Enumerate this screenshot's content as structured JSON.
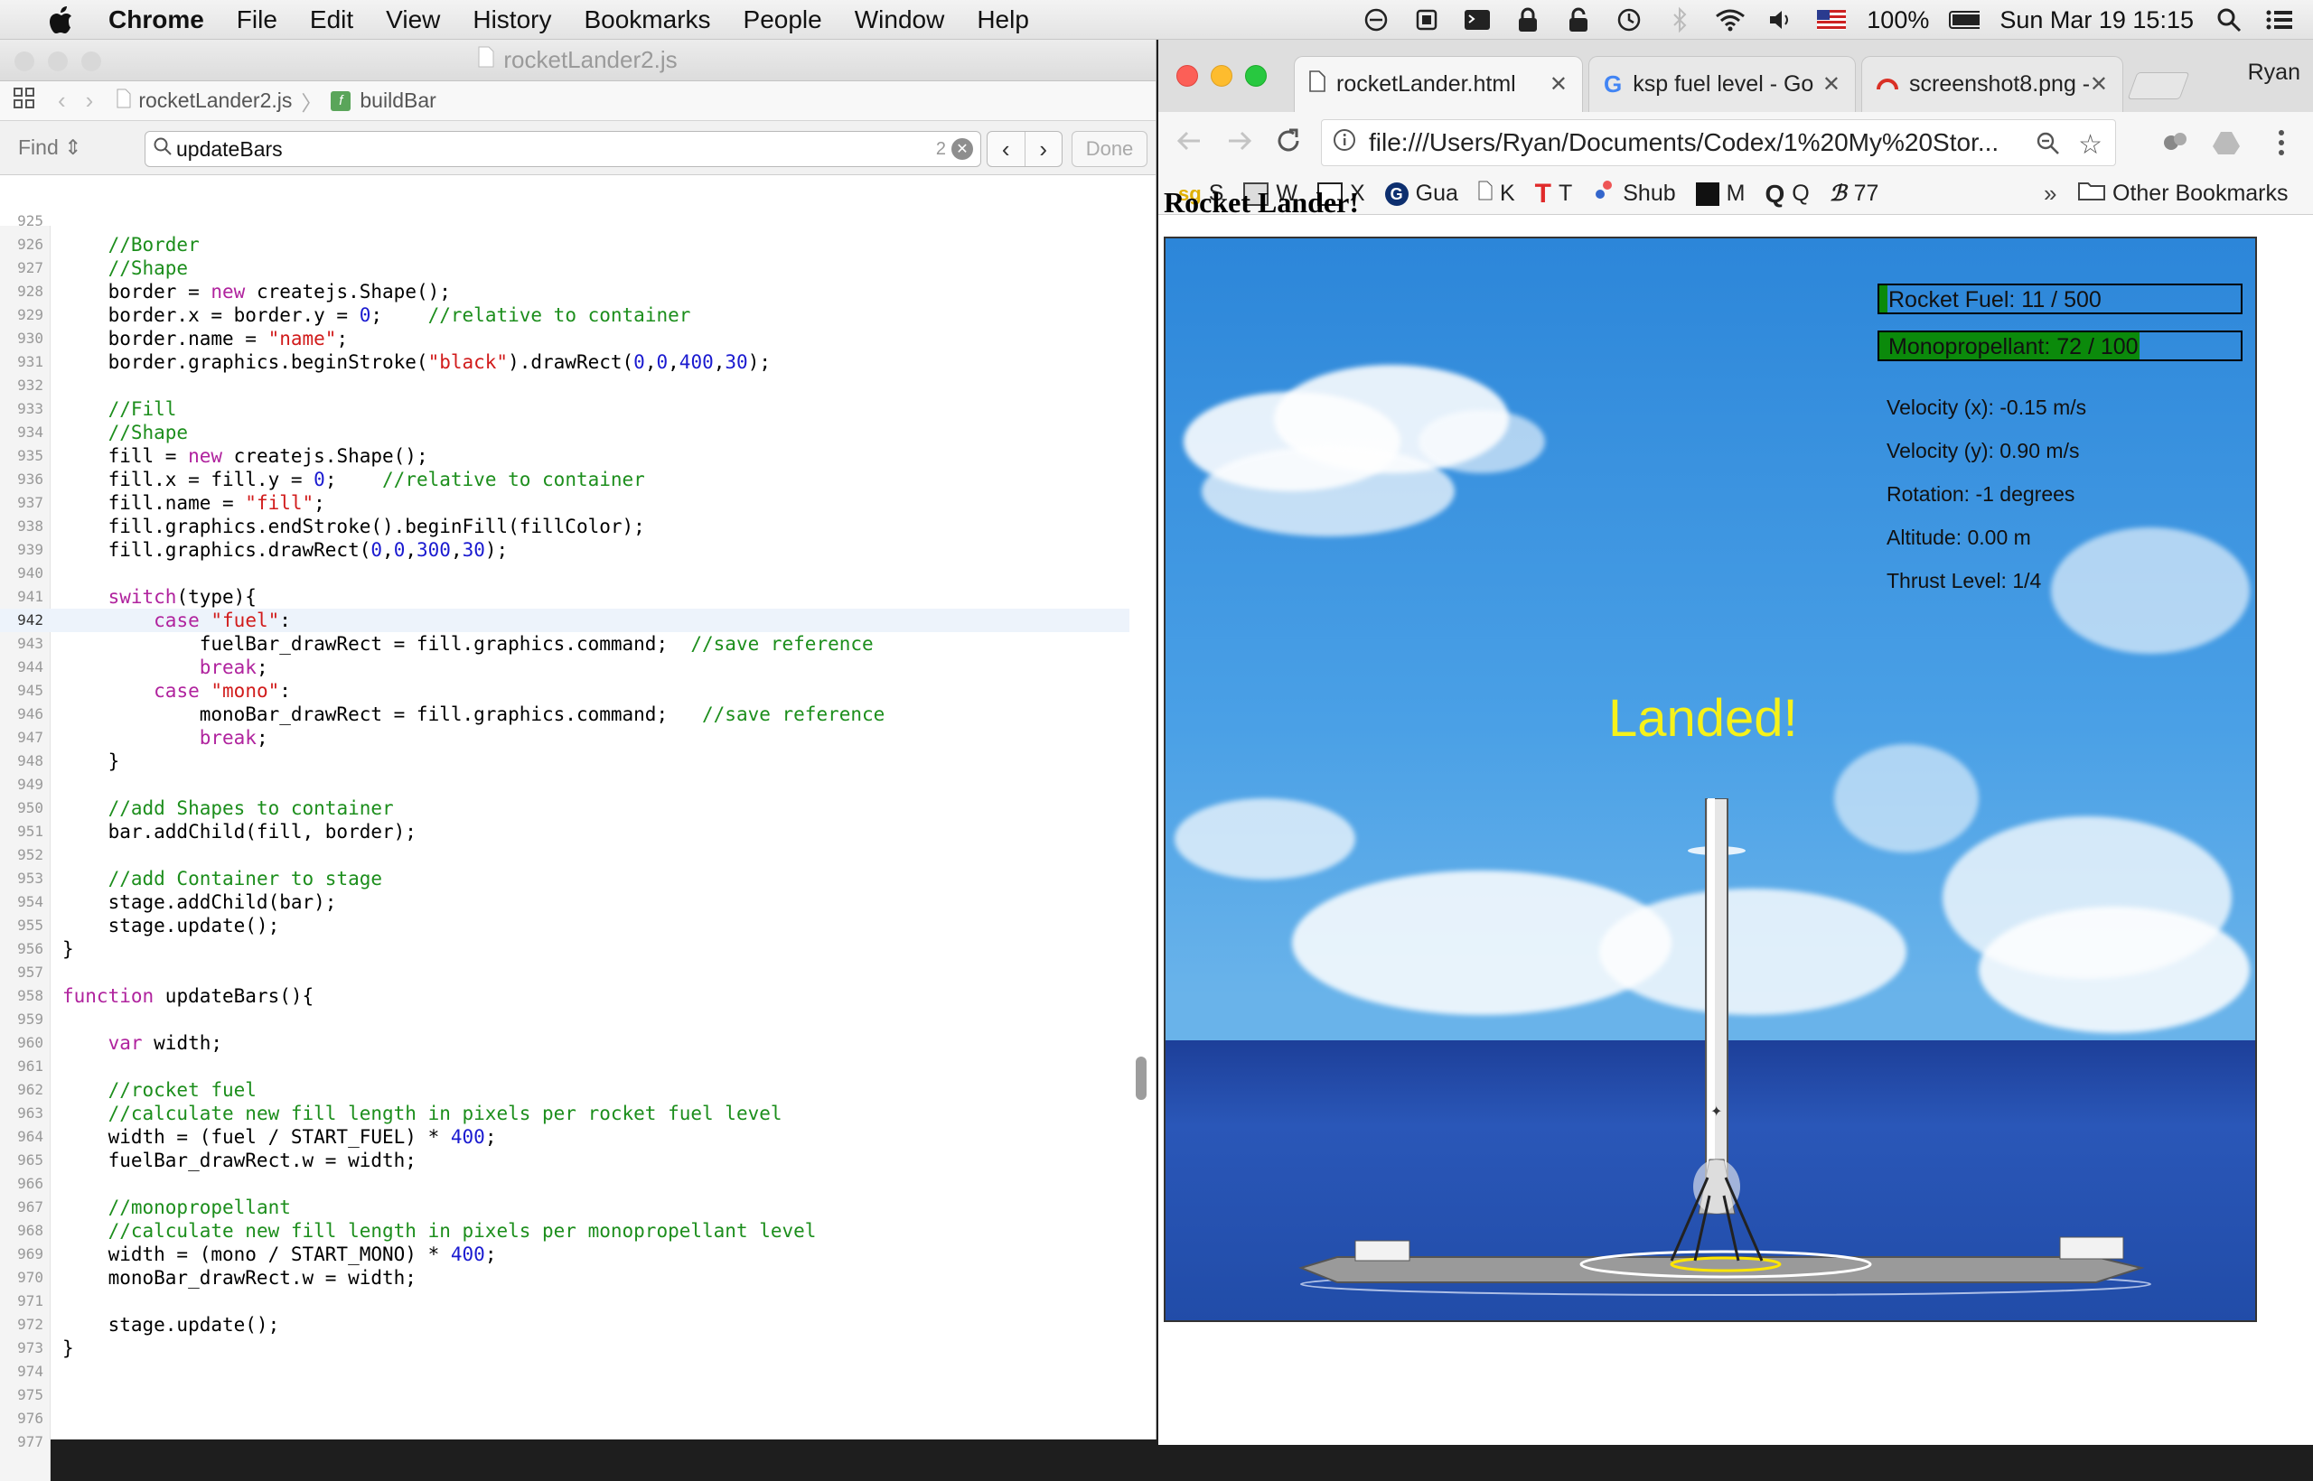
{
  "menubar": {
    "app": "Chrome",
    "items": [
      "File",
      "Edit",
      "View",
      "History",
      "Bookmarks",
      "People",
      "Window",
      "Help"
    ],
    "battery": "100%",
    "datetime": "Sun Mar 19  15:15"
  },
  "editor": {
    "title": "rocketLander2.js",
    "breadcrumb_file": "rocketLander2.js",
    "breadcrumb_func": "buildBar",
    "find_label": "Find",
    "find_query": "updateBars",
    "find_count": "2",
    "done_label": "Done"
  },
  "code_lines": [
    {
      "n": "925",
      "t": ""
    },
    {
      "n": "926",
      "t": "    <c>//Border</c>"
    },
    {
      "n": "927",
      "t": "    <c>//Shape</c>"
    },
    {
      "n": "928",
      "t": "    border = <k>new</k> createjs.Shape();"
    },
    {
      "n": "929",
      "t": "    border.x = border.y = <u>0</u>;    <c>//relative to container</c>"
    },
    {
      "n": "930",
      "t": "    border.name = <s>\"name\"</s>;"
    },
    {
      "n": "931",
      "t": "    border.graphics.beginStroke(<s>\"black\"</s>).drawRect(<u>0</u>,<u>0</u>,<u>400</u>,<u>30</u>);"
    },
    {
      "n": "932",
      "t": ""
    },
    {
      "n": "933",
      "t": "    <c>//Fill</c>"
    },
    {
      "n": "934",
      "t": "    <c>//Shape</c>"
    },
    {
      "n": "935",
      "t": "    fill = <k>new</k> createjs.Shape();"
    },
    {
      "n": "936",
      "t": "    fill.x = fill.y = <u>0</u>;    <c>//relative to container</c>"
    },
    {
      "n": "937",
      "t": "    fill.name = <s>\"fill\"</s>;"
    },
    {
      "n": "938",
      "t": "    fill.graphics.endStroke().beginFill(fillColor);"
    },
    {
      "n": "939",
      "t": "    fill.graphics.drawRect(<u>0</u>,<u>0</u>,<u>300</u>,<u>30</u>);"
    },
    {
      "n": "940",
      "t": ""
    },
    {
      "n": "941",
      "t": "    <k>switch</k>(type){"
    },
    {
      "n": "942",
      "t": "        <k>case</k> <s>\"fuel\"</s>:",
      "cur": true
    },
    {
      "n": "943",
      "t": "            fuelBar_drawRect = fill.graphics.command;  <c>//save reference</c>"
    },
    {
      "n": "944",
      "t": "            <k>break</k>;"
    },
    {
      "n": "945",
      "t": "        <k>case</k> <s>\"mono\"</s>:"
    },
    {
      "n": "946",
      "t": "            monoBar_drawRect = fill.graphics.command;   <c>//save reference</c>"
    },
    {
      "n": "947",
      "t": "            <k>break</k>;"
    },
    {
      "n": "948",
      "t": "    }"
    },
    {
      "n": "949",
      "t": ""
    },
    {
      "n": "950",
      "t": "    <c>//add Shapes to container</c>"
    },
    {
      "n": "951",
      "t": "    bar.addChild(fill, border);"
    },
    {
      "n": "952",
      "t": ""
    },
    {
      "n": "953",
      "t": "    <c>//add Container to stage</c>"
    },
    {
      "n": "954",
      "t": "    stage.addChild(bar);"
    },
    {
      "n": "955",
      "t": "    stage.update();"
    },
    {
      "n": "956",
      "t": "}"
    },
    {
      "n": "957",
      "t": ""
    },
    {
      "n": "958",
      "t": "<k>function</k> updateBars(){"
    },
    {
      "n": "959",
      "t": ""
    },
    {
      "n": "960",
      "t": "    <k>var</k> width;"
    },
    {
      "n": "961",
      "t": ""
    },
    {
      "n": "962",
      "t": "    <c>//rocket fuel</c>"
    },
    {
      "n": "963",
      "t": "    <c>//calculate new fill length in pixels per rocket fuel level</c>"
    },
    {
      "n": "964",
      "t": "    width = (fuel / START_FUEL) * <u>400</u>;"
    },
    {
      "n": "965",
      "t": "    fuelBar_drawRect.w = width;"
    },
    {
      "n": "966",
      "t": ""
    },
    {
      "n": "967",
      "t": "    <c>//monopropellant</c>"
    },
    {
      "n": "968",
      "t": "    <c>//calculate new fill length in pixels per monopropellant level</c>"
    },
    {
      "n": "969",
      "t": "    width = (mono / START_MONO) * <u>400</u>;"
    },
    {
      "n": "970",
      "t": "    monoBar_drawRect.w = width;"
    },
    {
      "n": "971",
      "t": ""
    },
    {
      "n": "972",
      "t": "    stage.update();"
    },
    {
      "n": "973",
      "t": "}"
    },
    {
      "n": "974",
      "t": ""
    },
    {
      "n": "975",
      "t": ""
    },
    {
      "n": "976",
      "t": ""
    },
    {
      "n": "977",
      "t": ""
    }
  ],
  "browser": {
    "tabs": [
      "rocketLander.html",
      "ksp fuel level - Go",
      "screenshot8.png -"
    ],
    "profile": "Ryan",
    "url": "file:///Users/Ryan/Documents/Codex/1%20My%20Stor...",
    "bookmarks": [
      "S",
      "W",
      "X",
      "Gua",
      "K",
      "T",
      "Shub",
      "M",
      "Q",
      "77"
    ],
    "other_bookmarks": "Other Bookmarks"
  },
  "game": {
    "page_title": "Rocket Lander!",
    "fuel_label": "Rocket Fuel: 11 / 500",
    "fuel_level": 0.022,
    "mono_label": "Monopropellant: 72 / 100",
    "mono_level": 0.72,
    "velocity_x": "Velocity (x): -0.15 m/s",
    "velocity_y": "Velocity (y): 0.90 m/s",
    "rotation": "Rotation: -1 degrees",
    "altitude": "Altitude: 0.00 m",
    "thrust": "Thrust Level: 1/4",
    "status": "Landed!"
  }
}
